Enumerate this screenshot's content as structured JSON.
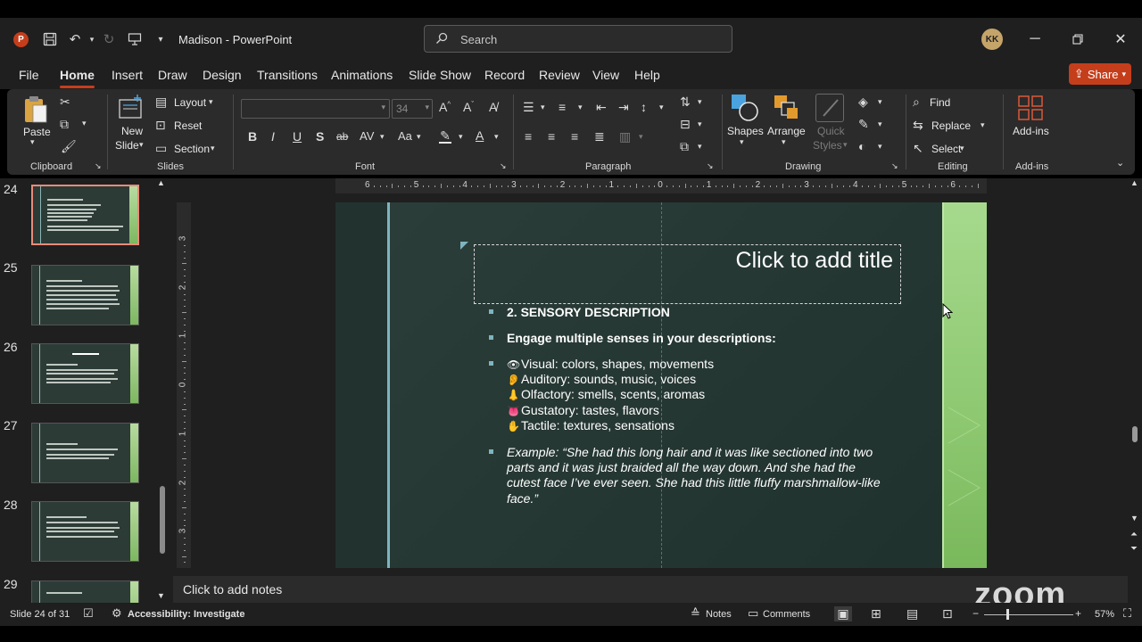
{
  "app": {
    "doc_name": "Madison",
    "app_name": "PowerPoint",
    "title": "Madison  -  PowerPoint",
    "search_placeholder": "Search",
    "user_initials": "KK"
  },
  "menu": {
    "tabs": [
      "File",
      "Home",
      "Insert",
      "Draw",
      "Design",
      "Transitions",
      "Animations",
      "Slide Show",
      "Record",
      "Review",
      "View",
      "Help"
    ],
    "active": "Home",
    "share_label": "Share"
  },
  "ribbon": {
    "clipboard": {
      "paste": "Paste",
      "label": "Clipboard"
    },
    "slides": {
      "new_slide_1": "New",
      "new_slide_2": "Slide",
      "layout": "Layout",
      "reset": "Reset",
      "section": "Section",
      "label": "Slides"
    },
    "font": {
      "size": "34",
      "label": "Font",
      "bold": "B",
      "italic": "I",
      "underline": "U",
      "shadow": "S",
      "strike": "ab",
      "spacing": "AV",
      "case": "Aa"
    },
    "paragraph": {
      "label": "Paragraph"
    },
    "drawing": {
      "shapes": "Shapes",
      "arrange": "Arrange",
      "quick_styles_1": "Quick",
      "quick_styles_2": "Styles",
      "label": "Drawing"
    },
    "editing": {
      "find": "Find",
      "replace": "Replace",
      "select": "Select",
      "label": "Editing"
    },
    "addins": {
      "addins": "Add-ins",
      "label": "Add-ins"
    }
  },
  "thumbnails": {
    "numbers": [
      "24",
      "25",
      "26",
      "27",
      "28",
      "29"
    ],
    "selected": "24"
  },
  "slide": {
    "title_placeholder": "Click to add title",
    "heading": "2. SENSORY DESCRIPTION",
    "subheading": "Engage multiple senses in your descriptions:",
    "senses": [
      {
        "icon": "👁",
        "text": "Visual: colors, shapes, movements"
      },
      {
        "icon": "👂",
        "text": "Auditory: sounds, music, voices"
      },
      {
        "icon": "👃",
        "text": "Olfactory: smells, scents, aromas"
      },
      {
        "icon": "👅",
        "text": "Gustatory: tastes, flavors"
      },
      {
        "icon": "✋",
        "text": "Tactile: textures, sensations"
      }
    ],
    "example_lines": [
      "Example: “She had this long hair and it was like sectioned into two",
      "parts and it was just braided all the way down. And she had the",
      "cutest face I’ve ever seen. She had this little fluffy marshmallow-like",
      "face.”"
    ]
  },
  "rulers": {
    "horizontal": [
      "6",
      "5",
      "4",
      "3",
      "2",
      "1",
      "0",
      "1",
      "2",
      "3",
      "4",
      "5",
      "6"
    ],
    "vertical": [
      "3",
      "2",
      "1",
      "0",
      "1",
      "2",
      "3"
    ]
  },
  "notes": {
    "placeholder": "Click to add notes"
  },
  "overlay": {
    "zoom_logo": "zoom"
  },
  "status": {
    "slide_info": "Slide 24 of 31",
    "accessibility": "Accessibility: Investigate",
    "notes": "Notes",
    "comments": "Comments",
    "zoom_level": "57%"
  },
  "colors": {
    "accent": "#c43e1c",
    "slide_bg": "#2c3e3a",
    "slide_accent_line": "#7fb4bf",
    "slide_edge_green": "#a6d98d"
  }
}
